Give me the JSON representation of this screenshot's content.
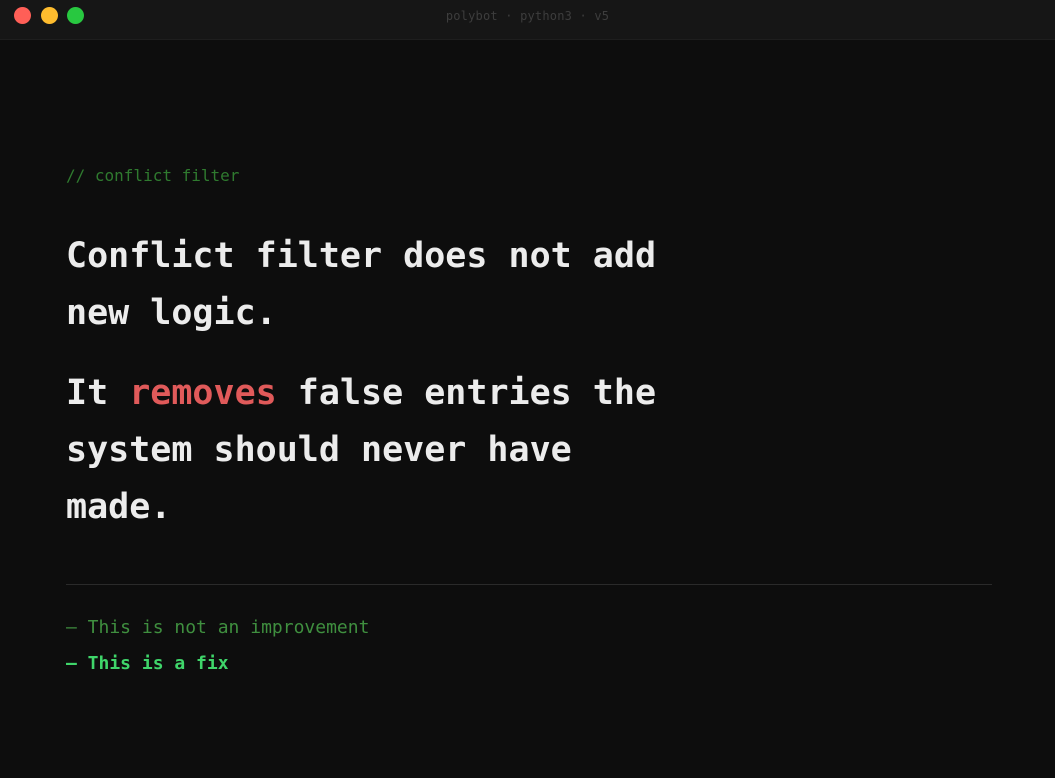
{
  "window": {
    "title": "polybot · python3 · v5"
  },
  "slide": {
    "comment": "// conflict filter",
    "headline": "Conflict filter does not add new logic.",
    "subline": {
      "prefix": "It ",
      "highlight": "removes",
      "suffix": " false entries the system should never have made."
    },
    "notes": [
      "— This is not an improvement",
      "— This is a fix"
    ]
  },
  "colors": {
    "background": "#0d0d0d",
    "titlebar": "#161616",
    "text": "#ececec",
    "highlight": "#e05a5a",
    "comment": "#2f7a2f",
    "note_muted": "#3f8f3f",
    "note_strong": "#3fd56a"
  }
}
